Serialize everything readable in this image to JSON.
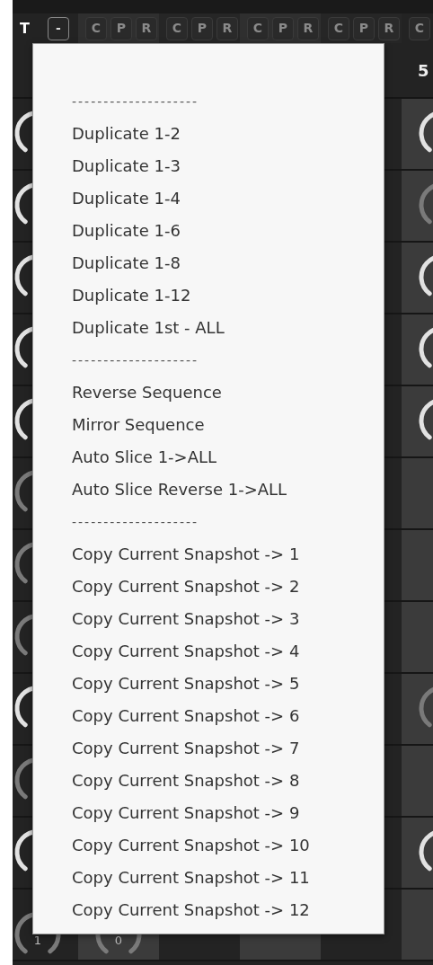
{
  "header": {
    "title_fragment": "T",
    "collapse_button": "-",
    "column_buttons": [
      [
        "C",
        "P",
        "R"
      ],
      [
        "C",
        "P",
        "R"
      ],
      [
        "C",
        "P",
        "R"
      ],
      [
        "C",
        "P",
        "R"
      ],
      [
        "C"
      ]
    ]
  },
  "track_label": "5",
  "rows": [
    {
      "left_knob": {
        "lit": true
      },
      "right_knob": {
        "lit": true
      }
    },
    {
      "left_knob": {
        "lit": true
      },
      "right_knob": {
        "lit": false
      }
    },
    {
      "left_knob": {
        "lit": true
      },
      "right_knob": {
        "lit": true
      }
    },
    {
      "left_knob": {
        "lit": true
      },
      "right_knob": {
        "lit": true
      }
    },
    {
      "left_knob": {
        "lit": true
      },
      "right_knob": {
        "lit": true
      }
    },
    {
      "left_knob": {
        "lit": false
      }
    },
    {
      "left_knob": {
        "lit": false
      }
    },
    {
      "left_knob": {
        "lit": false
      }
    },
    {
      "left_knob": {
        "lit": true
      },
      "right_knob": {
        "lit": false
      }
    },
    {
      "left_knob": {
        "lit": false
      }
    },
    {
      "left_knob": {
        "lit": true
      },
      "right_knob": {
        "lit": true
      }
    },
    {
      "left_knob": {
        "lit": false,
        "value": "1"
      },
      "second_knob": {
        "lit": false,
        "value": "0"
      }
    }
  ],
  "menu": {
    "items": [
      {
        "kind": "separator",
        "label": "--------------------"
      },
      {
        "kind": "item",
        "label": "Duplicate 1-2"
      },
      {
        "kind": "item",
        "label": "Duplicate 1-3"
      },
      {
        "kind": "item",
        "label": "Duplicate 1-4"
      },
      {
        "kind": "item",
        "label": "Duplicate 1-6"
      },
      {
        "kind": "item",
        "label": "Duplicate 1-8"
      },
      {
        "kind": "item",
        "label": "Duplicate 1-12"
      },
      {
        "kind": "item",
        "label": "Duplicate 1st - ALL"
      },
      {
        "kind": "separator",
        "label": "--------------------"
      },
      {
        "kind": "item",
        "label": "Reverse Sequence"
      },
      {
        "kind": "item",
        "label": "Mirror Sequence"
      },
      {
        "kind": "item",
        "label": "Auto Slice 1->ALL"
      },
      {
        "kind": "item",
        "label": "Auto Slice Reverse 1->ALL"
      },
      {
        "kind": "separator",
        "label": "--------------------"
      },
      {
        "kind": "item",
        "label": "Copy Current Snapshot -> 1"
      },
      {
        "kind": "item",
        "label": "Copy Current Snapshot -> 2"
      },
      {
        "kind": "item",
        "label": "Copy Current Snapshot -> 3"
      },
      {
        "kind": "item",
        "label": "Copy Current Snapshot -> 4"
      },
      {
        "kind": "item",
        "label": "Copy Current Snapshot -> 5"
      },
      {
        "kind": "item",
        "label": "Copy Current Snapshot -> 6"
      },
      {
        "kind": "item",
        "label": "Copy Current Snapshot -> 7"
      },
      {
        "kind": "item",
        "label": "Copy Current Snapshot -> 8"
      },
      {
        "kind": "item",
        "label": "Copy Current Snapshot -> 9"
      },
      {
        "kind": "item",
        "label": "Copy Current Snapshot -> 10"
      },
      {
        "kind": "item",
        "label": "Copy Current Snapshot -> 11"
      },
      {
        "kind": "item",
        "label": "Copy Current Snapshot -> 12"
      }
    ]
  }
}
